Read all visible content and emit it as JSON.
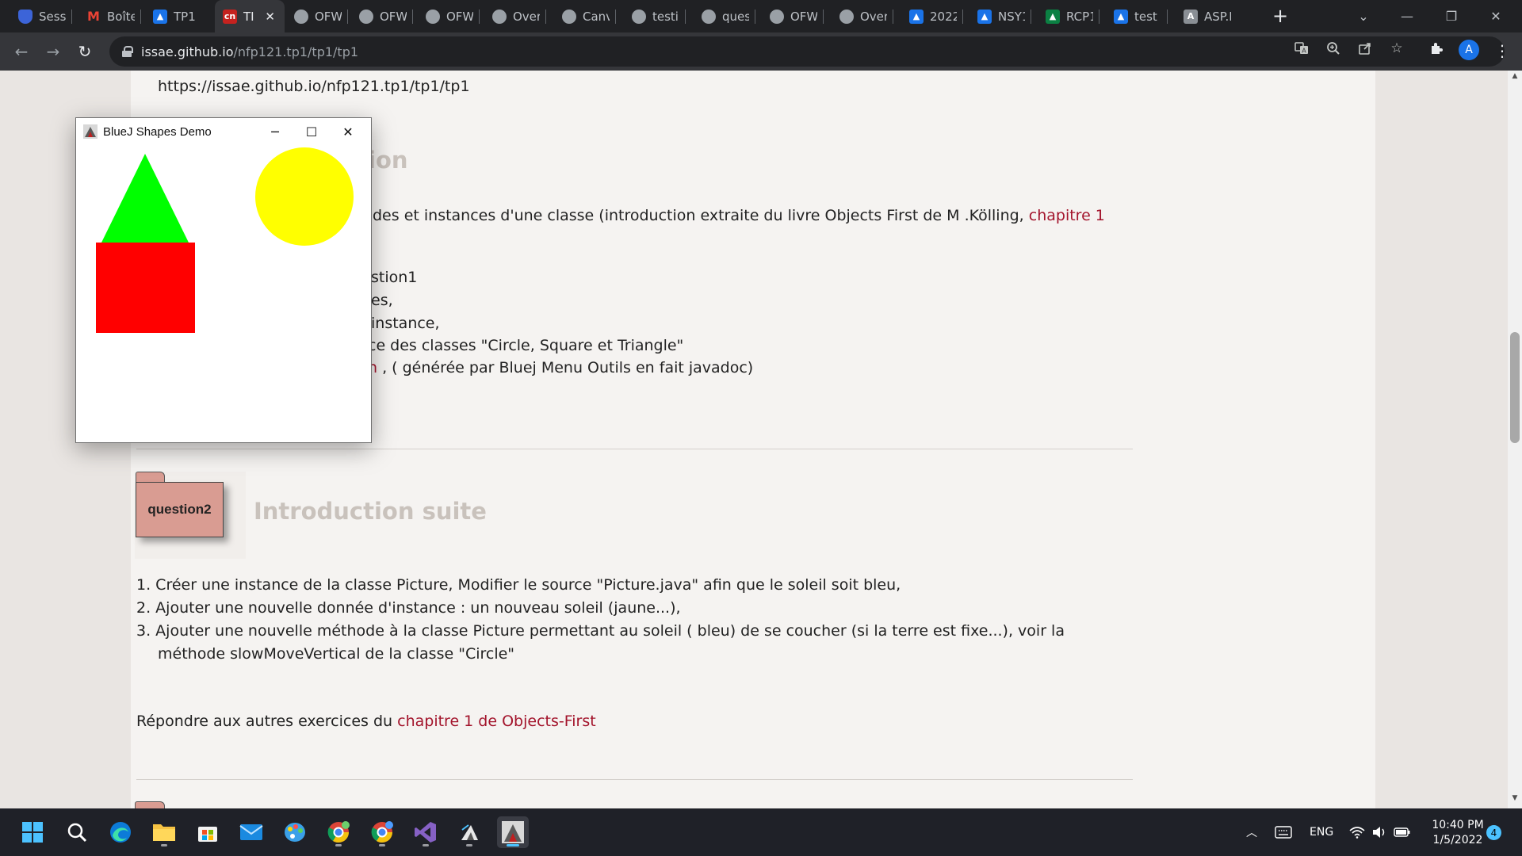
{
  "browser": {
    "tabs": [
      {
        "title": "Sessic",
        "icon": "shield-icon"
      },
      {
        "title": "Boîte",
        "icon": "gmail-icon"
      },
      {
        "title": "TP1",
        "icon": "classroom-icon"
      },
      {
        "title": "TI",
        "icon": "cnam-icon",
        "active": true
      },
      {
        "title": "OFW",
        "icon": "globe-icon"
      },
      {
        "title": "OFW",
        "icon": "globe-icon"
      },
      {
        "title": "OFW",
        "icon": "globe-icon"
      },
      {
        "title": "Overv",
        "icon": "globe-icon"
      },
      {
        "title": "Canva",
        "icon": "globe-icon"
      },
      {
        "title": "testin",
        "icon": "globe-icon"
      },
      {
        "title": "quest",
        "icon": "globe-icon"
      },
      {
        "title": "OFW",
        "icon": "globe-icon"
      },
      {
        "title": "Overv",
        "icon": "globe-icon"
      },
      {
        "title": "2022",
        "icon": "classroom-icon"
      },
      {
        "title": "NSY1",
        "icon": "classroom-icon"
      },
      {
        "title": "RCP1",
        "icon": "classroom-teal-icon"
      },
      {
        "title": "test S",
        "icon": "classroom-icon"
      },
      {
        "title": "ASP.N",
        "icon": "asp-icon"
      }
    ],
    "url_host": "issae.github.io",
    "url_path": "/nfp121.tp1/tp1/tp1",
    "profile_initial": "A"
  },
  "page": {
    "top_url": "https://issae.github.io/nfp121.tp1/tp1/tp1",
    "section1_heading_fragment": "ion",
    "intro_line": "des et instances d'une classe (introduction extraite du livre Objects First de M .Kölling, ",
    "intro_link": "chapitre 1",
    "partial_lines": [
      "stion1",
      "es,",
      "instance,",
      "ce des classes \"Circle, Square et Triangle\""
    ],
    "javadoc_link_fragment": "n",
    "javadoc_text": " , ( générée par Bluej Menu Outils en fait javadoc)",
    "folder_label": "question2",
    "section2_heading": "Introduction suite",
    "steps": [
      "Créer une instance de la classe Picture, Modifier le source \"Picture.java\" afin que le soleil soit bleu,",
      "Ajouter une nouvelle donnée d'instance : un nouveau soleil (jaune...),",
      "Ajouter une nouvelle méthode à la classe Picture permettant au soleil ( bleu) de se coucher (si la terre est fixe...), voir la"
    ],
    "step3_continuation": "méthode slowMoveVertical de la classe \"Circle\"",
    "answer_text": "Répondre aux autres exercices du ",
    "answer_link": "chapitre 1 de Objects-First"
  },
  "bluej": {
    "title": "BlueJ Shapes Demo",
    "shapes": {
      "triangle_color": "#00ff00",
      "square_color": "#ff0000",
      "sun_color": "#ffff00"
    }
  },
  "taskbar": {
    "apps": [
      "start-icon",
      "search-icon",
      "edge-icon",
      "file-explorer-icon",
      "store-icon",
      "mail-icon",
      "paint-icon",
      "chrome-profile-icon",
      "chrome-profile-icon",
      "visual-studio-icon",
      "bluej-icon",
      "bluej-shapes-icon"
    ],
    "language": "ENG",
    "time": "10:40 PM",
    "date": "1/5/2022",
    "notifications": "4"
  }
}
